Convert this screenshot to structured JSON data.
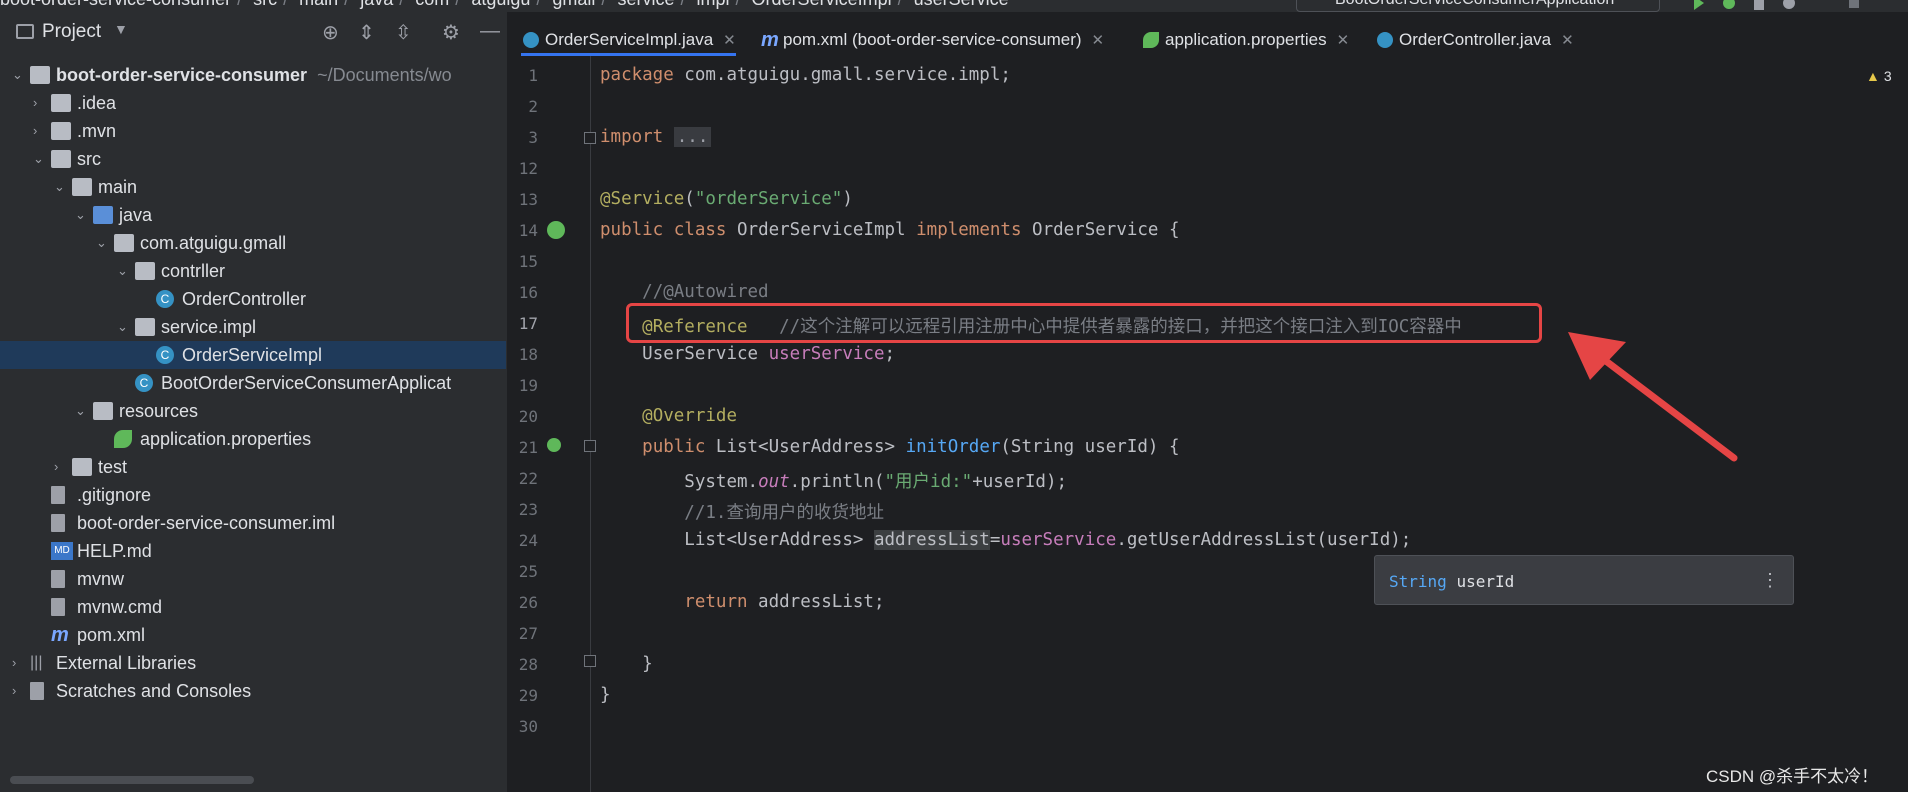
{
  "breadcrumbs": [
    "boot-order-service-consumer",
    "src",
    "main",
    "java",
    "com",
    "atguigu",
    "gmall",
    "service",
    "impl",
    "OrderServiceImpl",
    "userService"
  ],
  "run_config": "BootOrderServiceConsumerApplication",
  "project_panel": {
    "title": "Project",
    "tree": [
      {
        "label": "boot-order-service-consumer",
        "path": "~/Documents/wo",
        "depth": 0,
        "open": true,
        "icon": "module-folder-icon"
      },
      {
        "label": ".idea",
        "depth": 1,
        "open": false,
        "icon": "folder-icon"
      },
      {
        "label": ".mvn",
        "depth": 1,
        "open": false,
        "icon": "folder-icon"
      },
      {
        "label": "src",
        "depth": 1,
        "open": true,
        "icon": "folder-icon"
      },
      {
        "label": "main",
        "depth": 2,
        "open": true,
        "icon": "folder-icon"
      },
      {
        "label": "java",
        "depth": 3,
        "open": true,
        "icon": "source-folder-icon"
      },
      {
        "label": "com.atguigu.gmall",
        "depth": 4,
        "open": true,
        "icon": "package-icon"
      },
      {
        "label": "contrller",
        "depth": 5,
        "open": true,
        "icon": "package-icon"
      },
      {
        "label": "OrderController",
        "depth": 6,
        "icon": "class-icon"
      },
      {
        "label": "service.impl",
        "depth": 5,
        "open": true,
        "icon": "package-icon"
      },
      {
        "label": "OrderServiceImpl",
        "depth": 6,
        "icon": "class-icon",
        "selected": true
      },
      {
        "label": "BootOrderServiceConsumerApplicat",
        "depth": 5,
        "icon": "spring-class-icon"
      },
      {
        "label": "resources",
        "depth": 3,
        "open": true,
        "icon": "resources-folder-icon"
      },
      {
        "label": "application.properties",
        "depth": 4,
        "icon": "spring-properties-icon"
      },
      {
        "label": "test",
        "depth": 2,
        "open": false,
        "icon": "folder-icon"
      },
      {
        "label": ".gitignore",
        "depth": 1,
        "icon": "file-icon"
      },
      {
        "label": "boot-order-service-consumer.iml",
        "depth": 1,
        "icon": "file-icon"
      },
      {
        "label": "HELP.md",
        "depth": 1,
        "icon": "markdown-icon"
      },
      {
        "label": "mvnw",
        "depth": 1,
        "icon": "terminal-file-icon"
      },
      {
        "label": "mvnw.cmd",
        "depth": 1,
        "icon": "terminal-file-icon"
      },
      {
        "label": "pom.xml",
        "depth": 1,
        "icon": "maven-icon"
      },
      {
        "label": "External Libraries",
        "depth": 0,
        "open": false,
        "icon": "libraries-icon"
      },
      {
        "label": "Scratches and Consoles",
        "depth": 0,
        "open": false,
        "icon": "scratches-icon"
      }
    ]
  },
  "tabs": [
    {
      "label": "OrderServiceImpl.java",
      "icon": "class-icon",
      "active": true
    },
    {
      "label": "pom.xml (boot-order-service-consumer)",
      "icon": "maven-icon",
      "active": false
    },
    {
      "label": "application.properties",
      "icon": "spring-properties-icon",
      "active": false
    },
    {
      "label": "OrderController.java",
      "icon": "class-icon",
      "active": false
    }
  ],
  "inspection_count": "3",
  "line_numbers": [
    "1",
    "2",
    "3",
    "12",
    "13",
    "14",
    "15",
    "16",
    "17",
    "18",
    "19",
    "20",
    "21",
    "22",
    "23",
    "24",
    "25",
    "26",
    "27",
    "28",
    "29",
    "30"
  ],
  "code": {
    "l1_pkg": "package",
    "l1_name": " com.atguigu.gmall.service.impl;",
    "l3_import": "import",
    "l3_fold": "...",
    "l13_ann": "@Service",
    "l13_open": "(",
    "l13_str": "\"orderService\"",
    "l13_close": ")",
    "l14_public": "public",
    "l14_class": "class",
    "l14_name": "OrderServiceImpl",
    "l14_impl": "implements",
    "l14_iface": "OrderService {",
    "l16_cmt": "//@Autowired",
    "l17_ann": "@Reference",
    "l17_cmt": "//这个注解可以远程引用注册中心中提供者暴露的接口，并把这个接口注入到IOC容器中",
    "l18_type": "UserService ",
    "l18_field": "userService",
    "l18_semi": ";",
    "l20_ann": "@Override",
    "l21_public": "public",
    "l21_type": " List<UserAddress> ",
    "l21_fn": "initOrder",
    "l21_rest": "(String userId) {",
    "l22_a": "System.",
    "l22_out": "out",
    "l22_b": ".println(",
    "l22_str": "\"用户id:\"",
    "l22_c": "+userId);",
    "l23_cmt": "//1.查询用户的收货地址",
    "l24_a": "List<UserAddress> ",
    "l24_var": "addressList",
    "l24_eq": "=",
    "l24_field": "userService",
    "l24_b": ".getUserAddressList(userId);",
    "l26_ret": "return",
    "l26_rest": " addressList;",
    "l28": "}",
    "l29": "}"
  },
  "param_hint": {
    "type": "String",
    "name": "userId"
  },
  "watermark": "CSDN @杀手不太冷！",
  "colors": {
    "highlight_box": "#e54545",
    "arrow": "#e54545",
    "accent": "#3574f0"
  }
}
